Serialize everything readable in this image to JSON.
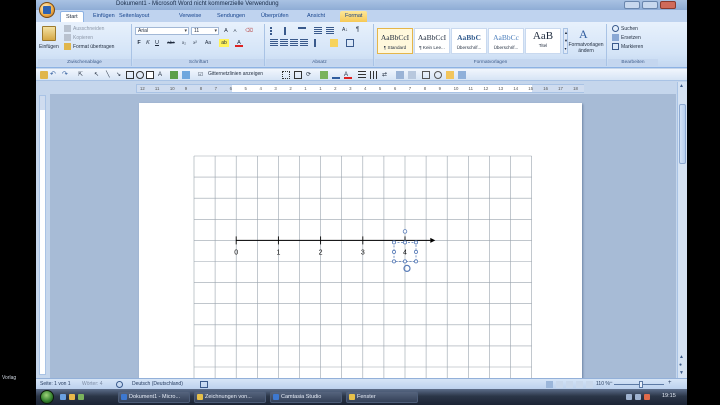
{
  "window": {
    "title": "Dokument1 - Microsoft Word nicht kommerzielle Verwendung"
  },
  "tabs": [
    {
      "label": "Start",
      "active": true
    },
    {
      "label": "Einfügen",
      "active": false
    },
    {
      "label": "Seitenlayout",
      "active": false
    },
    {
      "label": "Verweise",
      "active": false
    },
    {
      "label": "Sendungen",
      "active": false
    },
    {
      "label": "Überprüfen",
      "active": false
    },
    {
      "label": "Ansicht",
      "active": false
    },
    {
      "label": "Format",
      "active": false
    }
  ],
  "ribbon": {
    "clipboard": {
      "paste": "Einfügen",
      "cut": "Ausschneiden",
      "copy": "Kopieren",
      "format_painter": "Format übertragen",
      "group": "Zwischenablage"
    },
    "font": {
      "font_name": "Arial",
      "font_size": "11",
      "group": "Schriftart",
      "bold": "F",
      "italic": "K",
      "underline": "U",
      "strike": "abe",
      "subscript": "x₂",
      "superscript": "x²",
      "case": "Aa",
      "highlight": "ab",
      "color": "A"
    },
    "paragraph": {
      "group": "Absatz"
    },
    "styles": {
      "group": "Formatvorlagen",
      "items": [
        {
          "sample": "AaBbCcI",
          "name": "¶ Standard",
          "selected": true
        },
        {
          "sample": "AaBbCcI",
          "name": "¶ Kein Lee...",
          "selected": false
        },
        {
          "sample": "AaBbC",
          "name": "Überschrif...",
          "selected": false
        },
        {
          "sample": "AaBbCc",
          "name": "Überschrif...",
          "selected": false
        },
        {
          "sample": "AaB",
          "name": "Titel",
          "selected": false
        }
      ],
      "change": "Formatvorlagen ändern"
    },
    "editing": {
      "group": "Bearbeiten",
      "find": "Suchen",
      "replace": "Ersetzen",
      "select": "Markieren"
    }
  },
  "drawing_toolbar": {
    "gridlines": "Gitternetzlinien anzeigen"
  },
  "ruler": {
    "marks": [
      "12",
      "11",
      "10",
      "9",
      "8",
      "7",
      "6",
      "5",
      "4",
      "3",
      "2",
      "1",
      "1",
      "2",
      "3",
      "4",
      "5",
      "6",
      "7",
      "8",
      "9",
      "10",
      "11",
      "12",
      "13",
      "14",
      "15",
      "16",
      "17",
      "18"
    ]
  },
  "document": {
    "number_line": {
      "labels": [
        "0",
        "1",
        "2",
        "3",
        "4"
      ],
      "selected_label": "4"
    }
  },
  "statusbar": {
    "page": "Seite: 1 von 1",
    "words": "Wörter: 4",
    "language": "Deutsch (Deutschland)",
    "zoom": "110 %"
  },
  "taskbar": {
    "items": [
      {
        "label": "Dokument1 - Micro...",
        "color": "blue"
      },
      {
        "label": "Zeichnungen von...",
        "color": "yellow"
      },
      {
        "label": "Camtasia Studio",
        "color": "blue"
      },
      {
        "label": "Fenster",
        "color": "yellow"
      }
    ],
    "clock": "19:15"
  },
  "side_text": "Vorlag",
  "colors": {
    "ribbon_light": "#e8f1fc",
    "grid_line": "#9aa3ad",
    "selection": "#5a7db8",
    "arrow": "#000000"
  }
}
